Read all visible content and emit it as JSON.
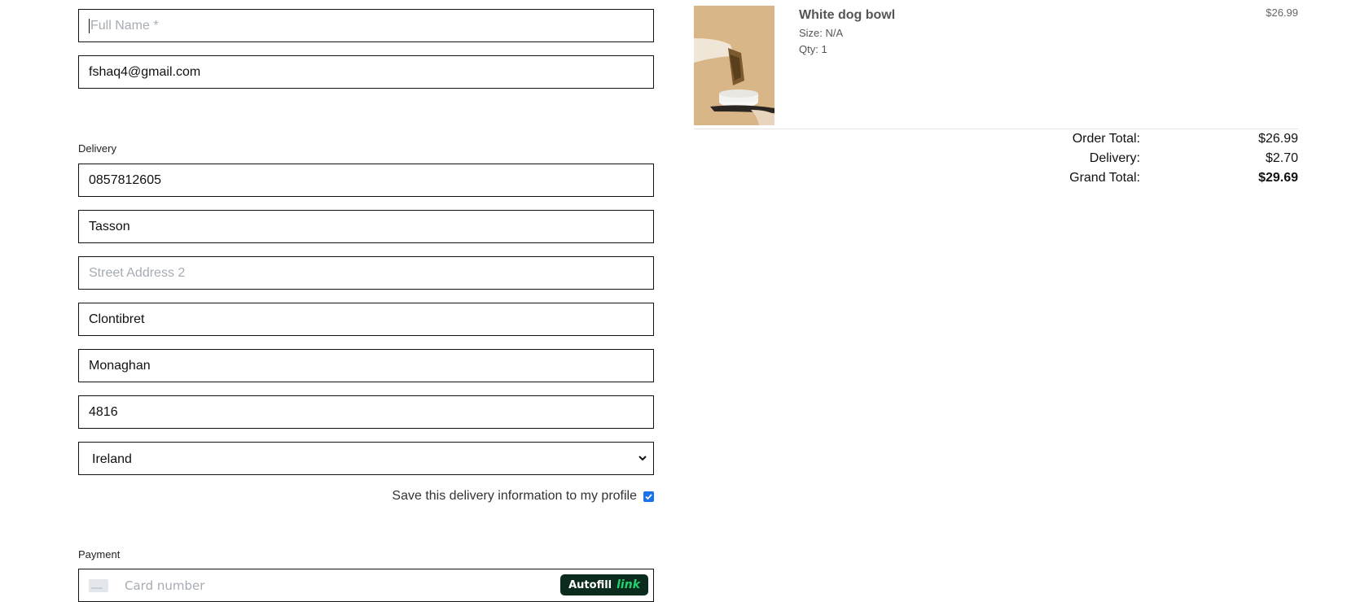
{
  "contact": {
    "full_name_placeholder": "Full Name *",
    "email_value": "fshaq4@gmail.com"
  },
  "delivery": {
    "section_label": "Delivery",
    "phone_value": "0857812605",
    "street1_value": "Tasson",
    "street2_placeholder": "Street Address 2",
    "town_value": "Clontibret",
    "county_value": "Monaghan",
    "postcode_value": "4816",
    "country_selected": "Ireland",
    "save_label": "Save this delivery information to my profile",
    "save_checked": true
  },
  "payment": {
    "section_label": "Payment",
    "card_placeholder": "Card number",
    "autofill_text": "Autofill",
    "autofill_brand": "link"
  },
  "order": {
    "product_name": "White dog bowl",
    "size": "Size: N/A",
    "qty": "Qty: 1",
    "price": "$26.99",
    "order_total_label": "Order Total:",
    "order_total_value": "$26.99",
    "delivery_label": "Delivery:",
    "delivery_value": "$2.70",
    "grand_total_label": "Grand Total:",
    "grand_total_value": "$29.69"
  },
  "colors": {
    "checkbox_accent": "#1a73e8",
    "autofill_bg": "#0b2b1c",
    "autofill_brand": "#22d172",
    "product_bg": "#d9b687"
  }
}
